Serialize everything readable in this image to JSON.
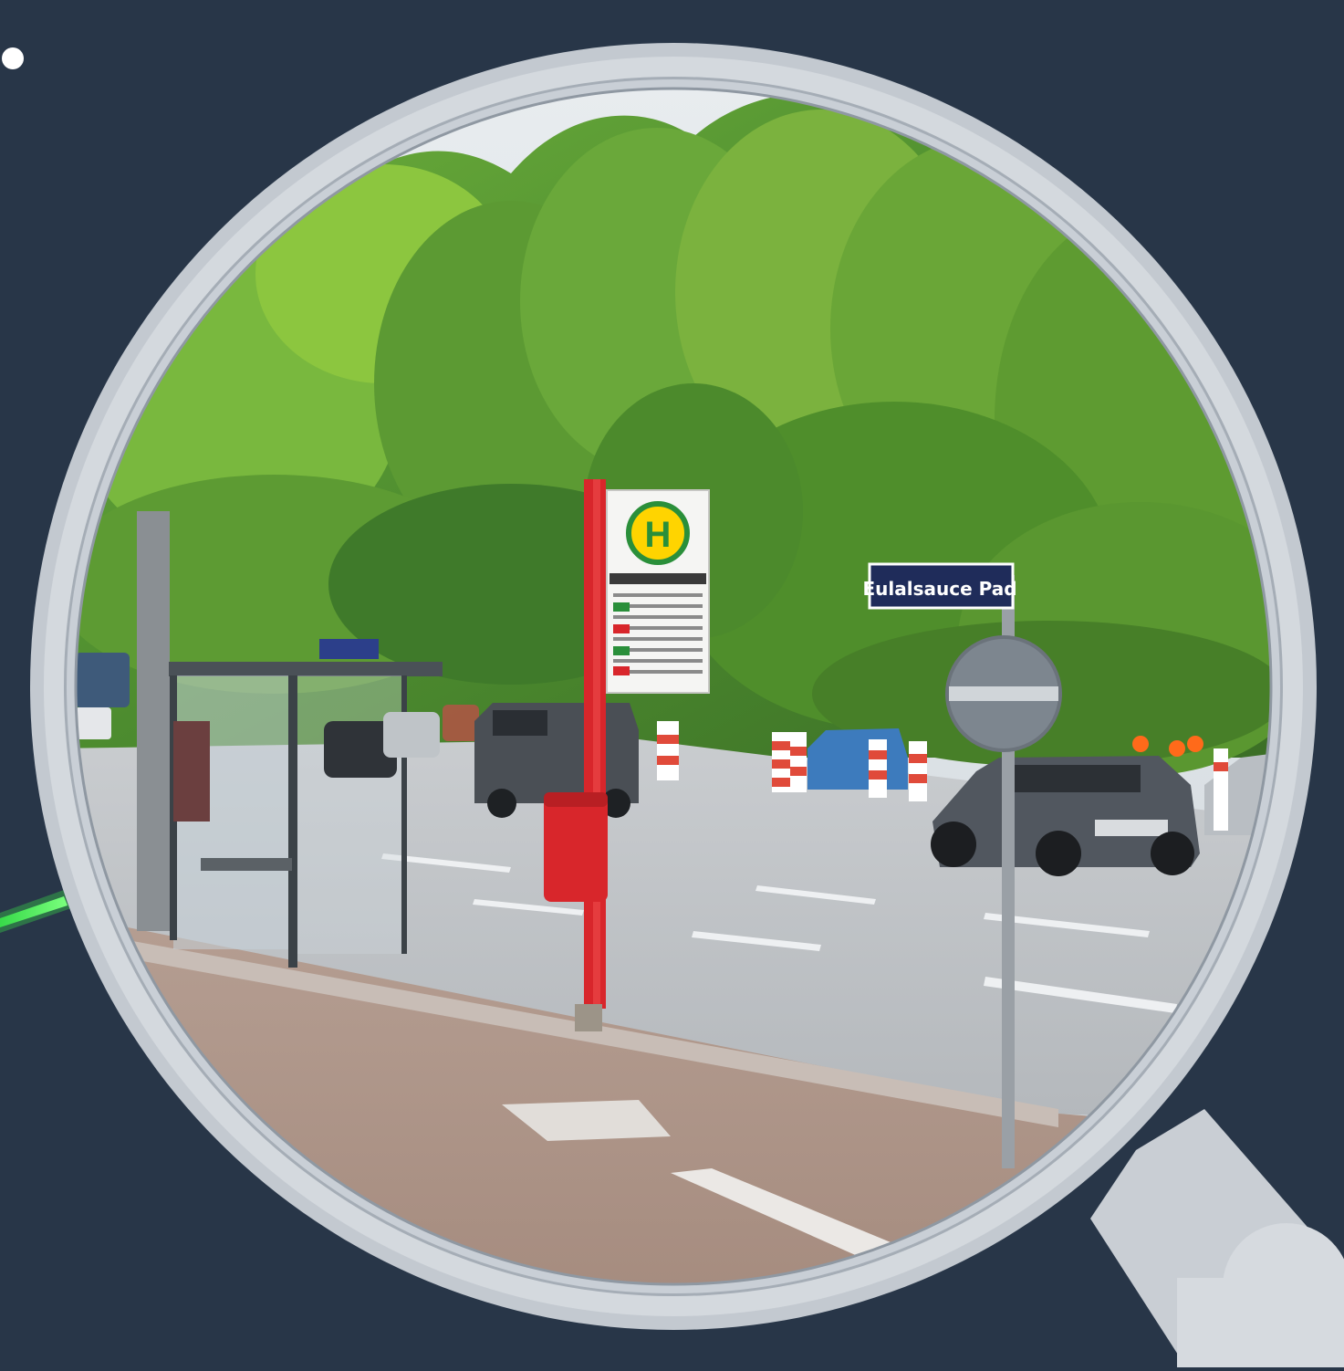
{
  "colors": {
    "background": "#283648",
    "lens_rim": "#c9ced4",
    "lens_rim_shadow": "#9aa3ad",
    "laser": "#39e64a",
    "sky": "#dfe4e8",
    "foliage_dark": "#3f7a2a",
    "foliage_light": "#8cc63f",
    "road": "#bfc3c7",
    "pavement": "#b49a8c",
    "bus_pole": "#d8262b",
    "street_sign": "#1f2c5a"
  },
  "icons": [
    "magnifying-glass-icon",
    "laser-beam",
    "bus-stop-h-sign-icon",
    "prohibition-sign-icon"
  ],
  "scene": {
    "bus_stop_symbol": "H",
    "street_sign_text": "Eulalsauce Pad"
  }
}
